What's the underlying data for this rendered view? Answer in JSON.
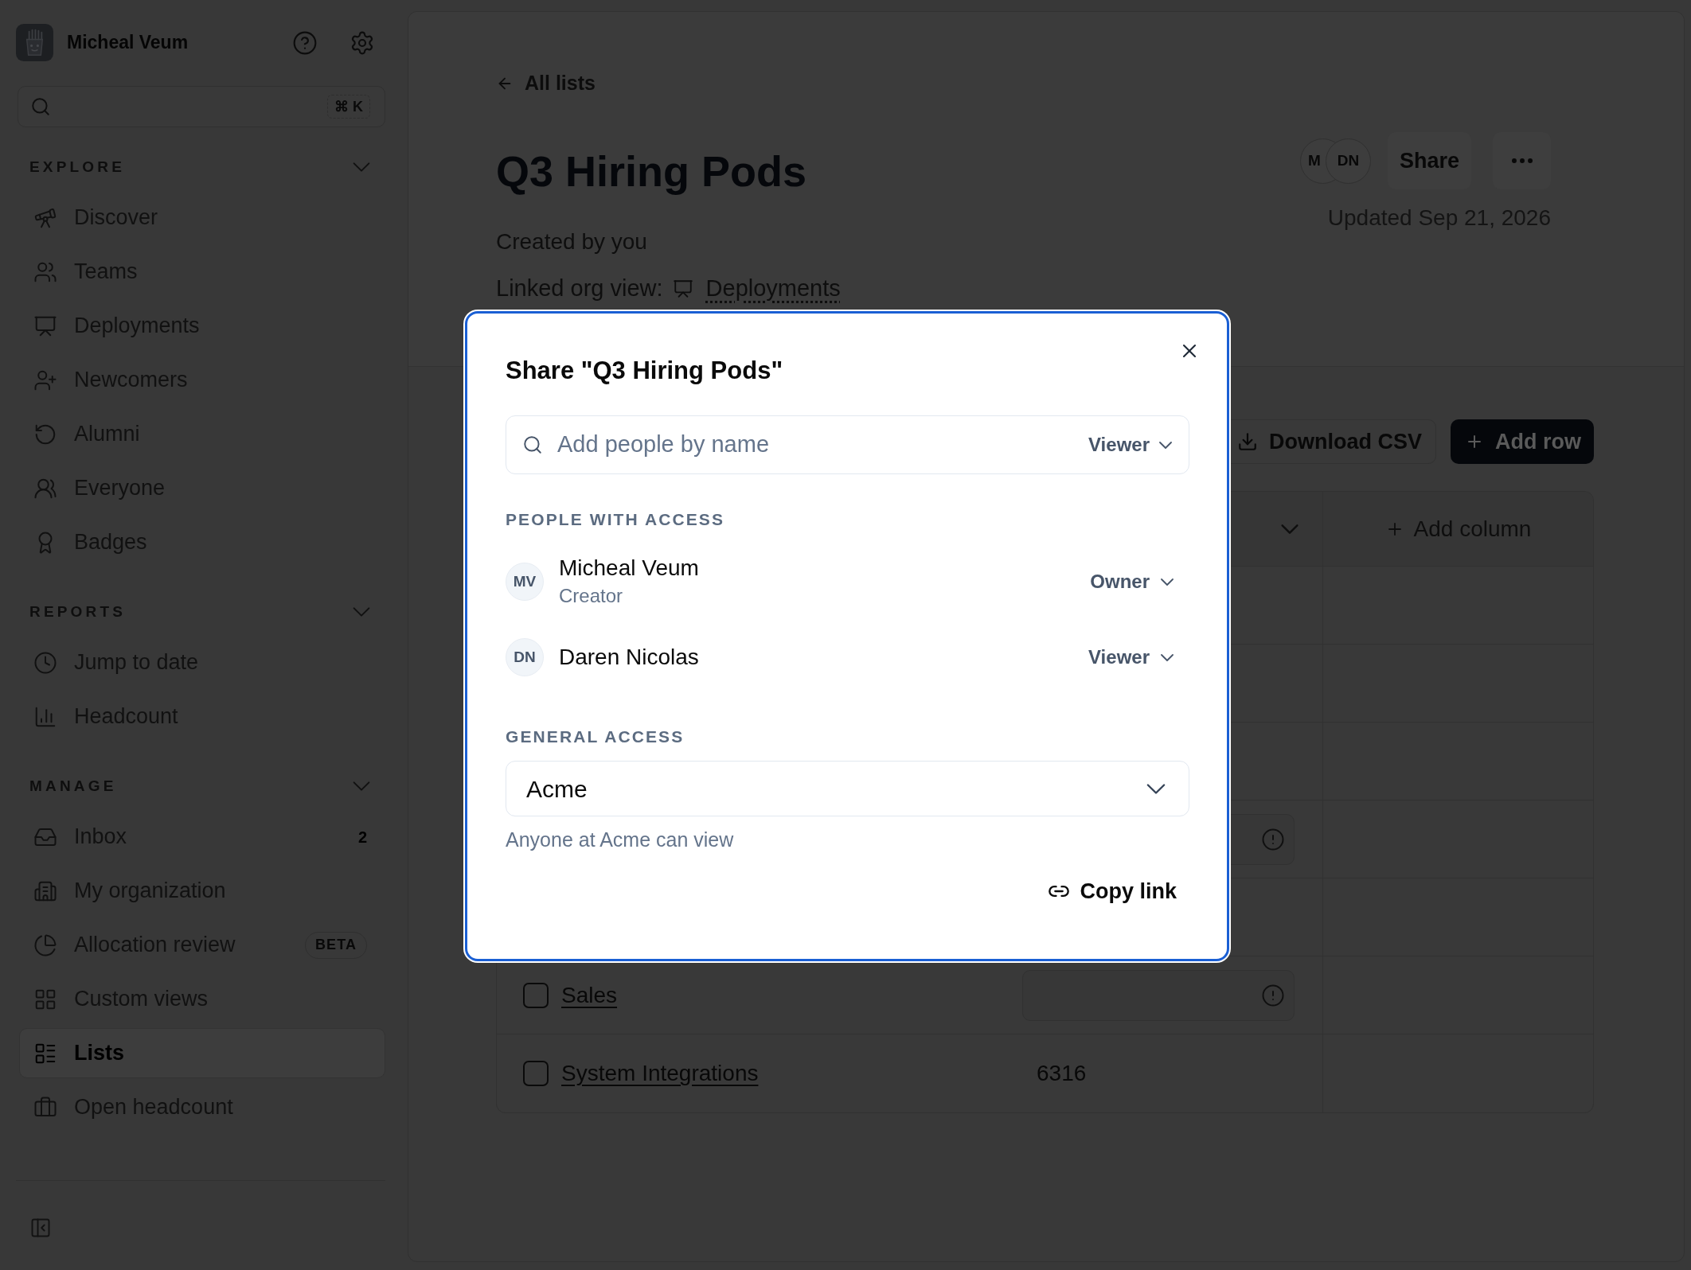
{
  "sidebar": {
    "user": {
      "name": "Micheal Veum"
    },
    "search": {
      "shortcut": "⌘ K"
    },
    "sections": [
      {
        "title": "EXPLORE",
        "expanded": true,
        "items": [
          {
            "label": "Discover",
            "selected": false
          },
          {
            "label": "Teams",
            "selected": false
          },
          {
            "label": "Deployments",
            "selected": false
          },
          {
            "label": "Newcomers",
            "selected": false
          },
          {
            "label": "Alumni",
            "selected": false
          },
          {
            "label": "Everyone",
            "selected": false
          },
          {
            "label": "Badges",
            "selected": false
          }
        ]
      },
      {
        "title": "REPORTS",
        "expanded": true,
        "items": [
          {
            "label": "Jump to date",
            "selected": false
          },
          {
            "label": "Headcount",
            "selected": false
          }
        ]
      },
      {
        "title": "MANAGE",
        "expanded": true,
        "items": [
          {
            "label": "Inbox",
            "count": "2",
            "selected": false
          },
          {
            "label": "My organization",
            "selected": false
          },
          {
            "label": "Allocation review",
            "badge": "BETA",
            "selected": false
          },
          {
            "label": "Custom views",
            "selected": false
          },
          {
            "label": "Lists",
            "selected": true
          },
          {
            "label": "Open headcount",
            "selected": false
          }
        ]
      }
    ]
  },
  "page": {
    "back_link": "All lists",
    "title": "Q3 Hiring Pods",
    "created": "Created by you",
    "linked_view": {
      "label": "Linked org view:",
      "link": "Deployments"
    },
    "collaborators": [
      {
        "initials": "M"
      },
      {
        "initials": "DN"
      }
    ],
    "share_button": "Share",
    "updated": "Updated Sep 21, 2026"
  },
  "toolbar": {
    "download_button": "Download CSV",
    "add_row_button": "Add row"
  },
  "table": {
    "add_column": "Add column",
    "rows": [
      {
        "kind": "covered",
        "warning": false
      },
      {
        "kind": "covered",
        "warning": false
      },
      {
        "kind": "covered",
        "warning": false
      },
      {
        "kind": "covered",
        "warning": true
      },
      {
        "kind": "covered",
        "warning": false
      },
      {
        "kind": "item",
        "name": "Sales",
        "checked": false,
        "warning": true
      },
      {
        "kind": "item",
        "name": "System Integrations",
        "checked": false,
        "warning": false,
        "value": "6316"
      }
    ]
  },
  "dialog": {
    "title": "Share \"Q3 Hiring Pods\"",
    "search": {
      "placeholder": "Add people by name",
      "role": "Viewer"
    },
    "people_heading": "PEOPLE WITH ACCESS",
    "people": [
      {
        "initials": "MV",
        "name": "Micheal Veum",
        "subtitle": "Creator",
        "role": "Owner"
      },
      {
        "initials": "DN",
        "name": "Daren Nicolas",
        "role": "Viewer"
      }
    ],
    "general_heading": "GENERAL ACCESS",
    "general_access": {
      "value": "Acme",
      "hint": "Anyone at Acme can view"
    },
    "copy_link": "Copy link"
  }
}
